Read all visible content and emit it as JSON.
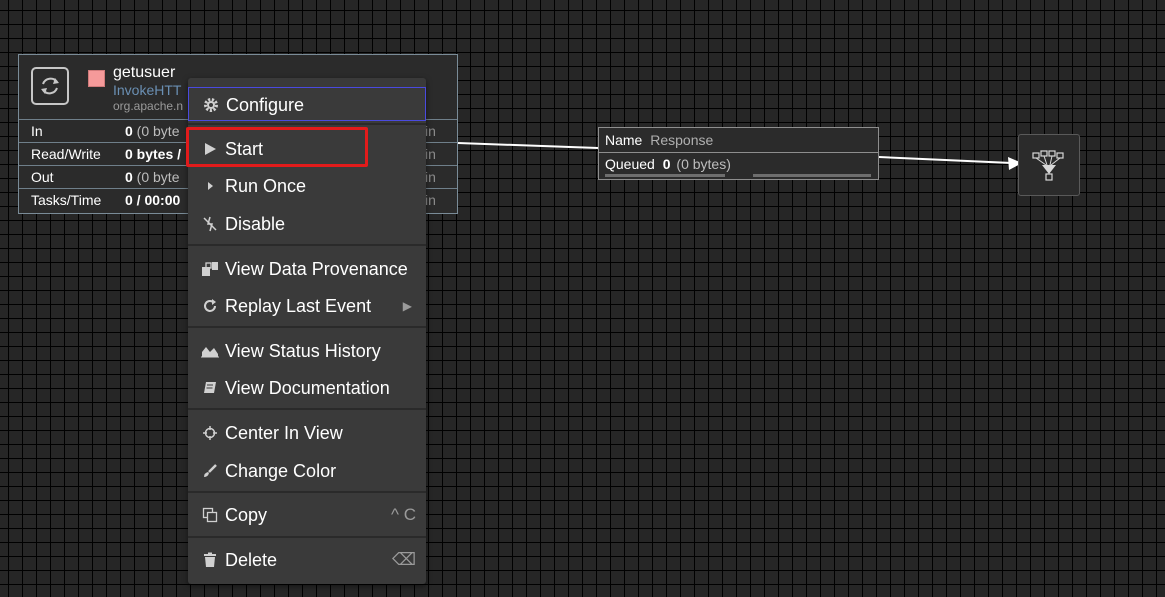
{
  "processor": {
    "name": "getusuer",
    "type": "InvokeHTT",
    "bundle": "org.apache.n",
    "status_color": "#f59a9a",
    "stats": [
      {
        "label": "In",
        "value_bold": "0",
        "value_rest": " (0 byte",
        "right": "in"
      },
      {
        "label": "Read/Write",
        "value_bold": "0 bytes /",
        "value_rest": "",
        "right": "in"
      },
      {
        "label": "Out",
        "value_bold": "0",
        "value_rest": " (0 byte",
        "right": "in"
      },
      {
        "label": "Tasks/Time",
        "value_bold": "0 / 00:00",
        "value_rest": "",
        "right": "in"
      }
    ]
  },
  "connection": {
    "name_label": "Name",
    "name_value": "Response",
    "queued_label": "Queued",
    "queued_count": "0",
    "queued_bytes": "(0 bytes)"
  },
  "funnel": {
    "icon": "funnel-icon"
  },
  "context_menu": {
    "items": [
      {
        "label": "Configure",
        "icon": "gear-icon"
      },
      {
        "label": "Start",
        "icon": "play-icon"
      },
      {
        "label": "Run Once",
        "icon": "caret-right-icon"
      },
      {
        "label": "Disable",
        "icon": "disable-icon"
      },
      {
        "label": "View Data Provenance",
        "icon": "provenance-icon"
      },
      {
        "label": "Replay Last Event",
        "icon": "replay-icon"
      },
      {
        "label": "View Status History",
        "icon": "area-chart-icon"
      },
      {
        "label": "View Documentation",
        "icon": "book-icon"
      },
      {
        "label": "Center In View",
        "icon": "crosshair-icon"
      },
      {
        "label": "Change Color",
        "icon": "paintbrush-icon"
      },
      {
        "label": "Copy",
        "icon": "copy-icon",
        "shortcut": "^ C"
      },
      {
        "label": "Delete",
        "icon": "trash-icon",
        "shortcut": "⌫"
      }
    ]
  },
  "colors": {
    "highlight": "#e21b1b",
    "canvas": "#262626",
    "menu": "#3a3a3a",
    "type_link": "#6a8fb3"
  }
}
